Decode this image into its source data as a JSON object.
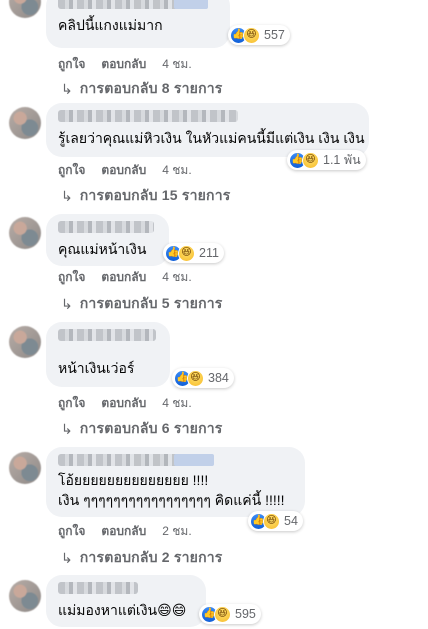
{
  "comments": [
    {
      "text": "คลิปนี้แกงแม่มาก",
      "reactions": {
        "like_icon": "like-icon",
        "haha_icon": "haha-icon",
        "count": "557"
      },
      "actions": {
        "like": "ถูกใจ",
        "reply": "ตอบกลับ",
        "time": "4 ชม."
      },
      "replies": "การตอบกลับ 8 รายการ"
    },
    {
      "text": "รู้เลยว่าคุณแม่หิวเงิน ในหัวแม่คนนี้มีแต่เงิน เงิน เงิน",
      "reactions": {
        "like_icon": "like-icon",
        "haha_icon": "haha-icon",
        "count": "1.1 พัน"
      },
      "actions": {
        "like": "ถูกใจ",
        "reply": "ตอบกลับ",
        "time": "4 ชม."
      },
      "replies": "การตอบกลับ 15 รายการ"
    },
    {
      "text": "คุณแม่หน้าเงิน",
      "reactions": {
        "like_icon": "like-icon",
        "haha_icon": "haha-icon",
        "count": "211"
      },
      "actions": {
        "like": "ถูกใจ",
        "reply": "ตอบกลับ",
        "time": "4 ชม."
      },
      "replies": "การตอบกลับ 5 รายการ"
    },
    {
      "text": "หน้าเงินเว่อร์",
      "reactions": {
        "like_icon": "like-icon",
        "haha_icon": "haha-icon",
        "count": "384"
      },
      "actions": {
        "like": "ถูกใจ",
        "reply": "ตอบกลับ",
        "time": "4 ชม."
      },
      "replies": "การตอบกลับ 6 รายการ"
    },
    {
      "text_line1": "โอ้ยยยยยยยยยยยยยย !!!!",
      "text_line2": "เงิน ๆๆๆๆๆๆๆๆๆๆๆๆๆๆๆๆๆ คิดแค่นี้ !!!!!",
      "reactions": {
        "like_icon": "like-icon",
        "haha_icon": "haha-icon",
        "count": "54"
      },
      "actions": {
        "like": "ถูกใจ",
        "reply": "ตอบกลับ",
        "time": "2 ชม."
      },
      "replies": "การตอบกลับ 2 รายการ"
    },
    {
      "text": "แม่มองหาแต่เงิน😄😄",
      "reactions": {
        "like_icon": "like-icon",
        "haha_icon": "haha-icon",
        "count": "595"
      }
    }
  ],
  "colors": {
    "bubble": "#f0f2f5",
    "meta": "#65676b",
    "like": "#1877f2",
    "haha": "#f7b928"
  }
}
